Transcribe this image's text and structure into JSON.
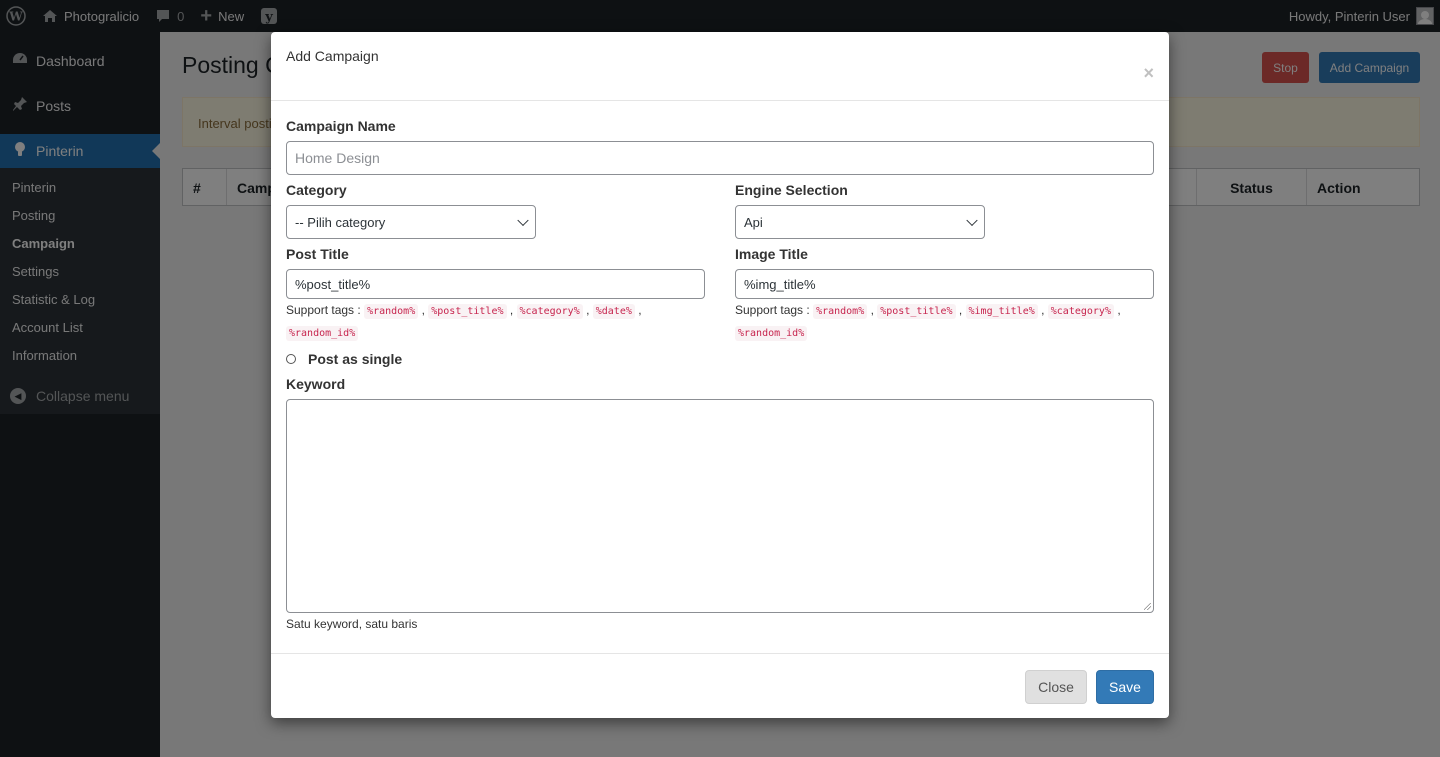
{
  "adminbar": {
    "site_name": "Photogralicio",
    "comments_count": "0",
    "new_label": "New",
    "greeting": "Howdy, Pinterin User"
  },
  "sidebar": {
    "items": [
      {
        "label": "Dashboard",
        "icon": "dashboard-icon"
      },
      {
        "label": "Posts",
        "icon": "pin-icon"
      },
      {
        "label": "Pinterin",
        "icon": "lightbulb-icon"
      }
    ],
    "submenu": [
      "Pinterin",
      "Posting",
      "Campaign",
      "Settings",
      "Statistic & Log",
      "Account List",
      "Information"
    ],
    "current_submenu": "Campaign",
    "collapse_label": "Collapse menu"
  },
  "page": {
    "title": "Posting C",
    "stop_label": "Stop",
    "add_campaign_label": "Add Campaign",
    "notice_text": "Interval posti",
    "columns": [
      "#",
      "Camp",
      "Status",
      "Action"
    ]
  },
  "modal": {
    "title": "Add Campaign",
    "close_x": "×",
    "campaign_name_label": "Campaign Name",
    "campaign_name_placeholder": "Home Design",
    "category_label": "Category",
    "category_value": "-- Pilih category",
    "engine_label": "Engine Selection",
    "engine_value": "Api",
    "post_title_label": "Post Title",
    "post_title_value": "%post_title%",
    "image_title_label": "Image Title",
    "image_title_value": "%img_title%",
    "support_tags_label": "Support tags :",
    "post_title_tags": [
      "%random%",
      "%post_title%",
      "%category%",
      "%date%",
      "%random_id%"
    ],
    "image_title_tags": [
      "%random%",
      "%post_title%",
      "%img_title%",
      "%category%",
      "%random_id%"
    ],
    "post_as_single_label": "Post as single",
    "keyword_label": "Keyword",
    "keyword_value": "",
    "keyword_help": "Satu keyword, satu baris",
    "close_button": "Close",
    "save_button": "Save"
  },
  "colors": {
    "accent": "#2271b1",
    "button_primary": "#337ab7",
    "button_danger": "#d9534f",
    "tag_text": "#c7254e"
  }
}
